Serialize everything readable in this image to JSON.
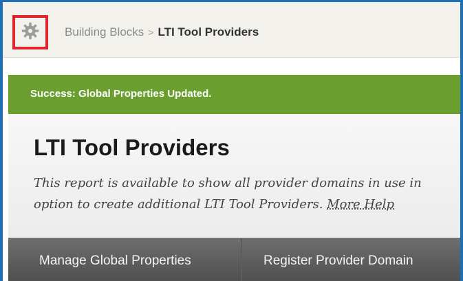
{
  "header": {
    "gear_icon": "gear-icon",
    "breadcrumb": {
      "parent": "Building Blocks",
      "separator": ">",
      "current": "LTI Tool Providers"
    }
  },
  "success": {
    "message": "Success: Global Properties Updated."
  },
  "main": {
    "title": "LTI Tool Providers",
    "description_line1": "This report is available to show all provider domains in use in",
    "description_line2": "option to create additional LTI Tool Providers.",
    "more_help": "More Help"
  },
  "actions": {
    "manage_global_properties": "Manage Global Properties",
    "register_provider_domain": "Register Provider Domain"
  },
  "colors": {
    "success_green": "#6a9e2f",
    "highlight_red": "#e0262c",
    "frame_blue": "#1f6fb5",
    "action_bar": "#5a5a5a"
  }
}
